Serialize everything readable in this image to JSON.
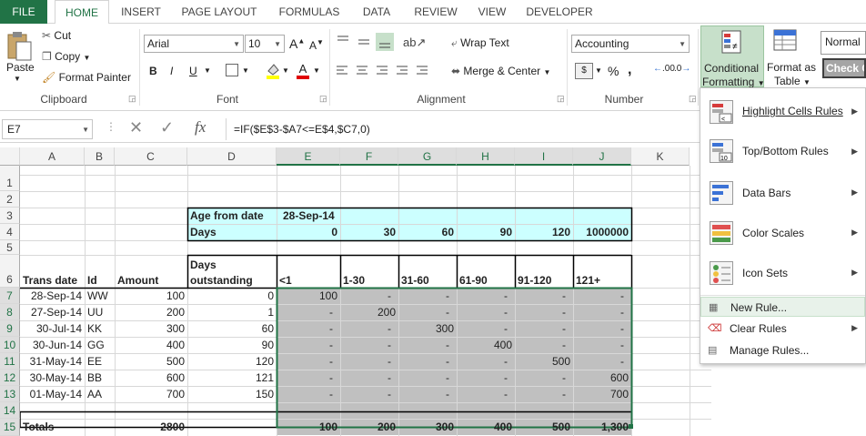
{
  "tabs": [
    "FILE",
    "HOME",
    "INSERT",
    "PAGE LAYOUT",
    "FORMULAS",
    "DATA",
    "REVIEW",
    "VIEW",
    "DEVELOPER"
  ],
  "clipboard": {
    "paste": "Paste",
    "cut": "Cut",
    "copy": "Copy",
    "format_painter": "Format Painter",
    "label": "Clipboard"
  },
  "font": {
    "name": "Arial",
    "size": "10",
    "bold": "B",
    "italic": "I",
    "underline": "U",
    "label": "Font",
    "grow": "A",
    "shrink": "A"
  },
  "alignment": {
    "wrap": "Wrap Text",
    "merge": "Merge & Center",
    "label": "Alignment"
  },
  "number": {
    "format": "Accounting",
    "percent": "%",
    "comma": ",",
    "label": "Number",
    "currency": "$",
    "inc_dec": ".00",
    "dec_dec": ".0"
  },
  "styles": {
    "conditional_l1": "Conditional",
    "conditional_l2": "Formatting",
    "format_l1": "Format as",
    "format_l2": "Table",
    "normal": "Normal",
    "check": "Check C"
  },
  "formula_bar": {
    "name_box": "E7",
    "formula": "=IF($E$3-$A7<=E$4,$C7,0)",
    "fx": "fx"
  },
  "columns": [
    "A",
    "B",
    "C",
    "D",
    "E",
    "F",
    "G",
    "H",
    "I",
    "J",
    "K"
  ],
  "rows": [
    "1",
    "2",
    "3",
    "4",
    "5",
    "6",
    "7",
    "8",
    "9",
    "10",
    "11",
    "12",
    "13",
    "14",
    "15"
  ],
  "sheet": {
    "age_label": "Age from date",
    "age_value": "28-Sep-14",
    "days_label": "Days",
    "days": [
      "0",
      "30",
      "60",
      "90",
      "120",
      "1000000"
    ],
    "headers": [
      "Trans date",
      "Id",
      "Amount",
      "Days",
      "outstanding",
      "<1",
      "1-30",
      "31-60",
      "61-90",
      "91-120",
      "121+"
    ],
    "data": [
      [
        "28-Sep-14",
        "WW",
        "100",
        "0",
        "100",
        "-",
        "-",
        "-",
        "-",
        "-"
      ],
      [
        "27-Sep-14",
        "UU",
        "200",
        "1",
        "-",
        "200",
        "-",
        "-",
        "-",
        "-"
      ],
      [
        "30-Jul-14",
        "KK",
        "300",
        "60",
        "-",
        "-",
        "300",
        "-",
        "-",
        "-"
      ],
      [
        "30-Jun-14",
        "GG",
        "400",
        "90",
        "-",
        "-",
        "-",
        "400",
        "-",
        "-"
      ],
      [
        "31-May-14",
        "EE",
        "500",
        "120",
        "-",
        "-",
        "-",
        "-",
        "500",
        "-"
      ],
      [
        "30-May-14",
        "BB",
        "600",
        "121",
        "-",
        "-",
        "-",
        "-",
        "-",
        "600"
      ],
      [
        "01-May-14",
        "AA",
        "700",
        "150",
        "-",
        "-",
        "-",
        "-",
        "-",
        "700"
      ]
    ],
    "totals": [
      "Totals",
      "2800",
      "100",
      "200",
      "300",
      "400",
      "500",
      "1,300"
    ]
  },
  "menu": {
    "items": [
      "Highlight Cells Rules",
      "Top/Bottom Rules",
      "Data Bars",
      "Color Scales",
      "Icon Sets"
    ],
    "actions": [
      "New Rule...",
      "Clear Rules",
      "Manage Rules..."
    ]
  },
  "colors": {
    "accent": "#217346",
    "highlight_cyan": "#ccffff",
    "selection_gray": "#c0c0c0"
  }
}
